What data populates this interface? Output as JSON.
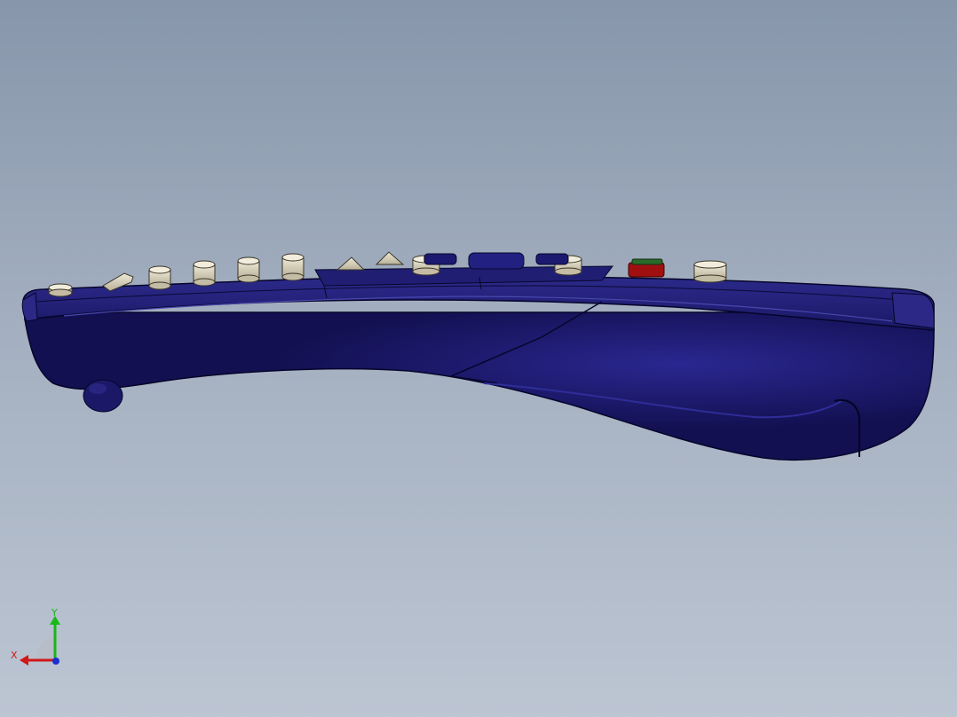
{
  "viewport": {
    "background_top": "#8796ab",
    "background_bottom": "#bcc5d2"
  },
  "model": {
    "name": "remote-control",
    "body_color": "#1c1a66",
    "body_dark": "#0b0a3a",
    "button_color": "#d9d2bd",
    "record_button_color": "#a01010"
  },
  "triad": {
    "x_label": "X",
    "y_label": "Y",
    "x_color": "#d01818",
    "y_color": "#18b818",
    "z_color": "#1830d0"
  }
}
